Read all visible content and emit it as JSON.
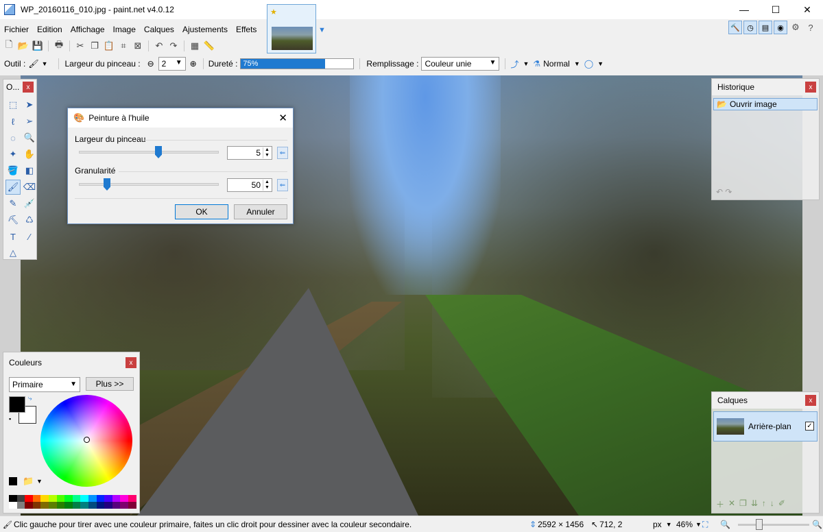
{
  "window": {
    "title": "WP_20160116_010.jpg - paint.net v4.0.12",
    "minimize": "—",
    "maximize": "☐",
    "close": "✕"
  },
  "menu": [
    "Fichier",
    "Edition",
    "Affichage",
    "Image",
    "Calques",
    "Ajustements",
    "Effets"
  ],
  "options_bar": {
    "tool_label": "Outil :",
    "brush_width_label": "Largeur du pinceau :",
    "brush_width_value": "2",
    "hardness_label": "Dureté :",
    "hardness_value": "75%",
    "hardness_fraction": 0.75,
    "fill_label": "Remplissage :",
    "fill_value": "Couleur unie",
    "blend_mode": "Normal"
  },
  "tools_panel": {
    "title": "O...",
    "close": "x"
  },
  "dialog": {
    "title": "Peinture à l'huile",
    "close": "✕",
    "brush_width_label": "Largeur du pinceau",
    "brush_width_value": "5",
    "coarseness_label": "Granularité",
    "coarseness_value": "50",
    "ok_label": "OK",
    "cancel_label": "Annuler"
  },
  "history": {
    "title": "Historique",
    "close": "x",
    "items": [
      "Ouvrir image"
    ]
  },
  "layers": {
    "title": "Calques",
    "close": "x",
    "items": [
      {
        "name": "Arrière-plan",
        "visible": true
      }
    ]
  },
  "colors": {
    "title": "Couleurs",
    "close": "x",
    "mode": "Primaire",
    "more_label": "Plus >>",
    "primary": "#000000",
    "secondary": "#ffffff",
    "palette": [
      "#000000",
      "#404040",
      "#ff0000",
      "#ff6a00",
      "#ffd800",
      "#b6ff00",
      "#4cff00",
      "#00ff21",
      "#00ff90",
      "#00ffff",
      "#0094ff",
      "#0026ff",
      "#4800ff",
      "#b200ff",
      "#ff00dc",
      "#ff006e",
      "#ffffff",
      "#808080",
      "#7f0000",
      "#7f3300",
      "#7f6a00",
      "#5b7f00",
      "#267f00",
      "#007f0e",
      "#007f46",
      "#007f7f",
      "#004a7f",
      "#00137f",
      "#21007f",
      "#57007f",
      "#7f006e",
      "#7f0037"
    ]
  },
  "status": {
    "message": "Clic gauche pour tirer avec une couleur primaire, faites un clic droit pour dessiner avec la couleur secondaire.",
    "image_size": "2592 × 1456",
    "cursor_pos": "712, 2",
    "unit": "px",
    "zoom": "46%"
  }
}
